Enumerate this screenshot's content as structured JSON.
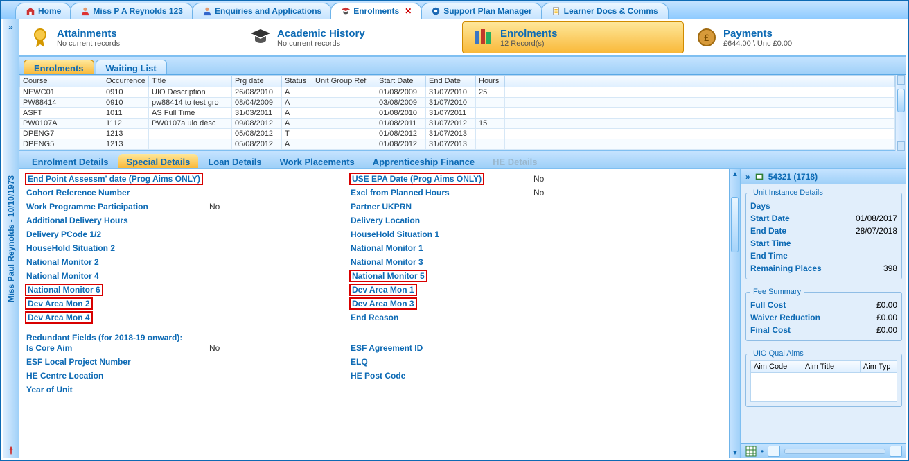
{
  "sidebar": {
    "learner": "Miss Paul Reynolds - 10/10/1973"
  },
  "tabs": [
    {
      "label": "Home",
      "icon": "home-icon"
    },
    {
      "label": "Miss P A Reynolds 123",
      "icon": "person-icon"
    },
    {
      "label": "Enquiries and Applications",
      "icon": "person-icon"
    },
    {
      "label": "Enrolments",
      "icon": "cap-icon",
      "active": true,
      "close": true
    },
    {
      "label": "Support Plan Manager",
      "icon": "lifebuoy-icon"
    },
    {
      "label": "Learner Docs & Comms",
      "icon": "doc-icon"
    }
  ],
  "summary": {
    "attainments": {
      "title": "Attainments",
      "sub": "No current records"
    },
    "history": {
      "title": "Academic History",
      "sub": "No current records"
    },
    "enrolments": {
      "title": "Enrolments",
      "sub": "12 Record(s)"
    },
    "payments": {
      "title": "Payments",
      "sub": "£644.00 \\ Unc £0.00"
    }
  },
  "subtabs": [
    "Enrolments",
    "Waiting List"
  ],
  "subtab_active": "Enrolments",
  "grid": {
    "headers": [
      "Course",
      "Occurrence",
      "Title",
      "Prg date",
      "Status",
      "Unit Group Ref",
      "Start Date",
      "End Date",
      "Hours"
    ],
    "sort_col": "Occurrence",
    "rows": [
      [
        "NEWC01",
        "0910",
        "UIO Description",
        "26/08/2010",
        "A",
        "",
        "01/08/2009",
        "31/07/2010",
        "25"
      ],
      [
        "PW88414",
        "0910",
        "pw88414 to test gro",
        "08/04/2009",
        "A",
        "",
        "03/08/2009",
        "31/07/2010",
        ""
      ],
      [
        "ASFT",
        "1011",
        "AS Full Time",
        "31/03/2011",
        "A",
        "",
        "01/08/2010",
        "31/07/2011",
        ""
      ],
      [
        "PW0107A",
        "1112",
        "PW0107a uio desc",
        "09/08/2012",
        "A",
        "",
        "01/08/2011",
        "31/07/2012",
        "15"
      ],
      [
        "DPENG7",
        "1213",
        "",
        "05/08/2012",
        "T",
        "",
        "01/08/2012",
        "31/07/2013",
        ""
      ],
      [
        "DPENG5",
        "1213",
        "",
        "05/08/2012",
        "A",
        "",
        "01/08/2012",
        "31/07/2013",
        ""
      ]
    ]
  },
  "dtabs": [
    "Enrolment Details",
    "Special Details",
    "Loan Details",
    "Work Placements",
    "Apprenticeship Finance",
    "HE Details"
  ],
  "dtab_active": "Special Details",
  "dtab_disabled": "HE Details",
  "form": {
    "left": [
      {
        "l": "End Point Assessm' date (Prog Aims ONLY)",
        "v": "",
        "hl": true
      },
      {
        "l": "Cohort Reference Number",
        "v": ""
      },
      {
        "l": "Work Programme Participation",
        "v": "No"
      },
      {
        "l": "Additional Delivery Hours",
        "v": ""
      },
      {
        "l": "Delivery PCode 1/2",
        "v": ""
      },
      {
        "l": "HouseHold Situation 2",
        "v": ""
      },
      {
        "l": "National Monitor 2",
        "v": ""
      },
      {
        "l": "National Monitor 4",
        "v": ""
      },
      {
        "l": "National Monitor 6",
        "v": "",
        "hl": true
      },
      {
        "l": "Dev Area Mon 2",
        "v": "",
        "hl": true
      },
      {
        "l": "Dev Area Mon 4",
        "v": "",
        "hl": true
      }
    ],
    "right": [
      {
        "l": "USE EPA Date (Prog Aims ONLY)",
        "v": "No",
        "hl": true
      },
      {
        "l": "Excl from Planned Hours",
        "v": "No"
      },
      {
        "l": "Partner UKPRN",
        "v": ""
      },
      {
        "l": "Delivery Location",
        "v": ""
      },
      {
        "l": "HouseHold Situation 1",
        "v": ""
      },
      {
        "l": "National Monitor 1",
        "v": ""
      },
      {
        "l": "National Monitor 3",
        "v": ""
      },
      {
        "l": "National Monitor 5",
        "v": "",
        "hl": true
      },
      {
        "l": "Dev Area Mon 1",
        "v": "",
        "hl": true
      },
      {
        "l": "Dev Area Mon 3",
        "v": "",
        "hl": true
      },
      {
        "l": "End Reason",
        "v": ""
      }
    ],
    "section": "Redundant Fields (for 2018-19 onward):",
    "left2": [
      {
        "l": "Is Core Aim",
        "v": "No"
      },
      {
        "l": "ESF Local Project Number",
        "v": ""
      },
      {
        "l": "HE Centre Location",
        "v": ""
      },
      {
        "l": "Year of Unit",
        "v": ""
      }
    ],
    "right2": [
      {
        "l": "ESF Agreement ID",
        "v": ""
      },
      {
        "l": "ELQ",
        "v": ""
      },
      {
        "l": "HE Post Code",
        "v": ""
      }
    ]
  },
  "right_panel": {
    "header": "54321 (1718)",
    "uid": {
      "legend": "Unit Instance Details",
      "rows": [
        {
          "k": "Days",
          "v": ""
        },
        {
          "k": "Start Date",
          "v": "01/08/2017"
        },
        {
          "k": "End Date",
          "v": "28/07/2018"
        },
        {
          "k": "Start Time",
          "v": ""
        },
        {
          "k": "End Time",
          "v": ""
        },
        {
          "k": "Remaining Places",
          "v": "398"
        }
      ]
    },
    "fee": {
      "legend": "Fee Summary",
      "rows": [
        {
          "k": "Full Cost",
          "v": "£0.00"
        },
        {
          "k": "Waiver Reduction",
          "v": "£0.00"
        },
        {
          "k": "Final Cost",
          "v": "£0.00"
        }
      ]
    },
    "aims": {
      "legend": "UIO Qual Aims",
      "headers": [
        "Aim Code",
        "Aim Title",
        "Aim Typ"
      ]
    }
  }
}
